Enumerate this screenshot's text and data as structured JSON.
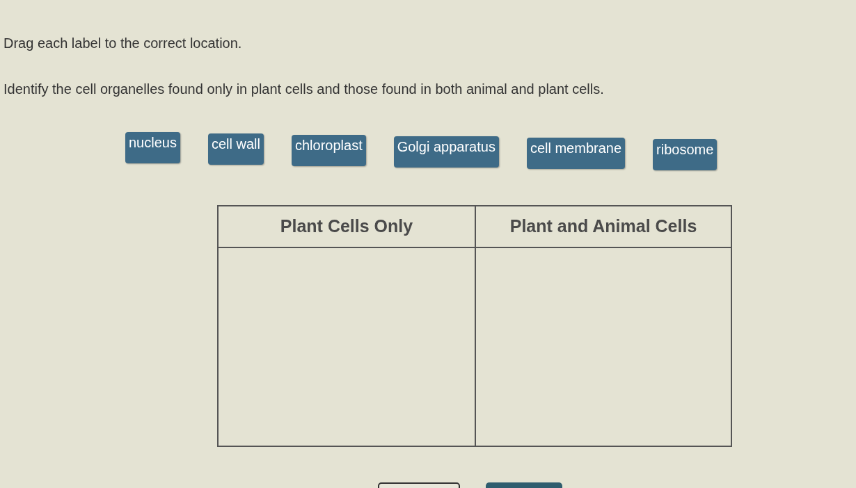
{
  "instructions": [
    "Drag each label to the correct location.",
    "Identify the cell organelles found only in plant cells and those found in both animal and plant cells."
  ],
  "labels": [
    "nucleus",
    "cell wall",
    "chloroplast",
    "Golgi apparatus",
    "cell membrane",
    "ribosome"
  ],
  "table": {
    "columns": [
      "Plant Cells Only",
      "Plant and Animal Cells"
    ]
  },
  "buttons": [
    {
      "kind": "outline"
    },
    {
      "kind": "filled"
    }
  ]
}
